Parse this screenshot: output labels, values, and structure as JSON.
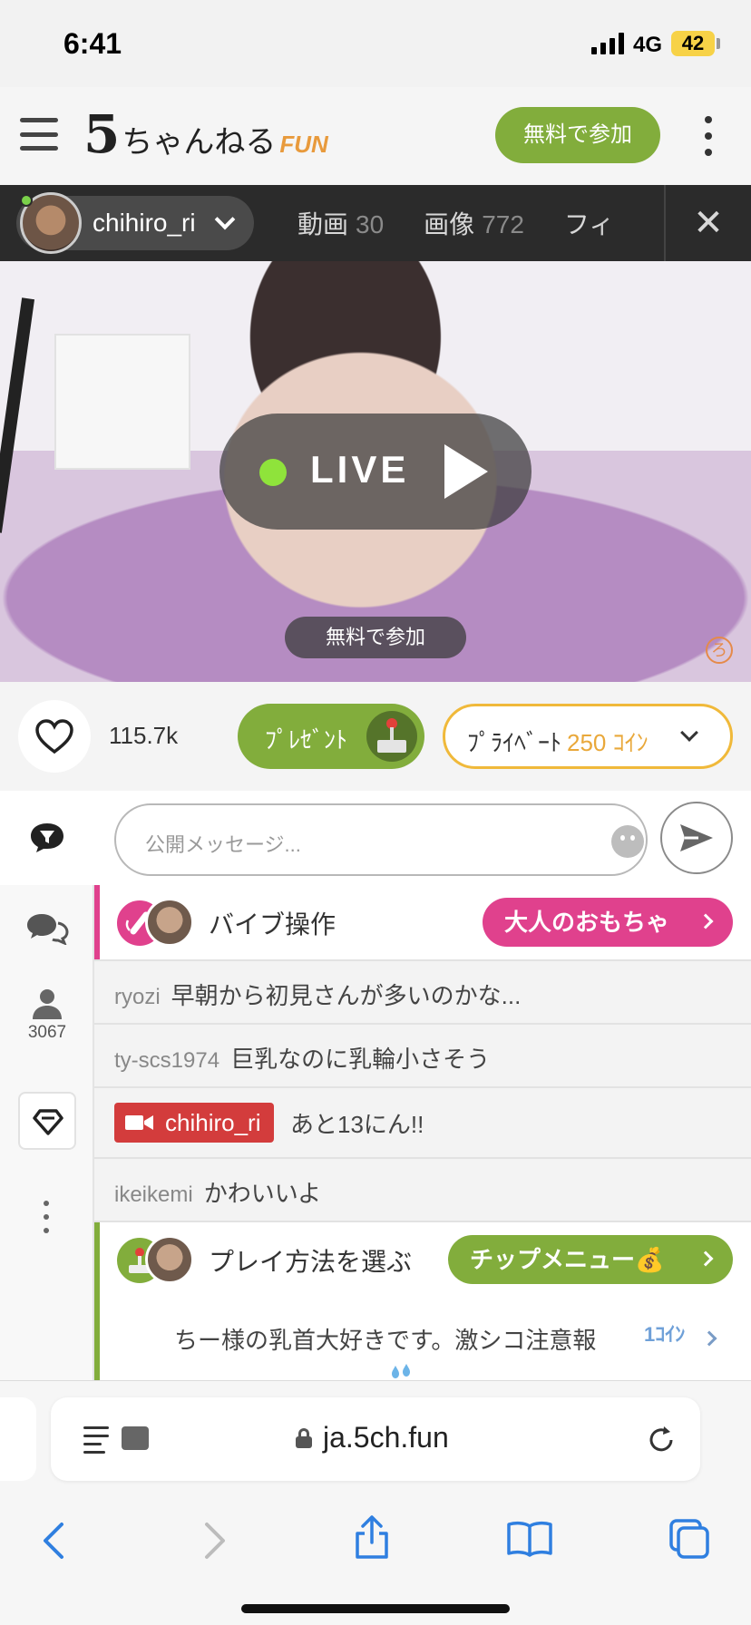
{
  "status_bar": {
    "time": "6:41",
    "network": "4G",
    "battery": "42"
  },
  "header": {
    "logo_main": "5",
    "logo_kana": "ちゃんねる",
    "logo_suffix": "FUN",
    "join_label": "無料で参加"
  },
  "user_bar": {
    "username": "chihiro_ri",
    "tabs": [
      {
        "label": "動画",
        "count": "30"
      },
      {
        "label": "画像",
        "count": "772"
      },
      {
        "label": "フィ",
        "count": ""
      }
    ]
  },
  "video": {
    "live_label": "LIVE",
    "join_label": "無料で参加",
    "watermark": "ろ"
  },
  "actions": {
    "likes": "115.7k",
    "present_label": "ﾌﾟﾚｾﾞﾝﾄ",
    "private_label": "ﾌﾟﾗｲﾍﾞｰﾄ",
    "private_cost": "250 ｺｲﾝ"
  },
  "rail": {
    "viewers": "3067"
  },
  "chat": {
    "placeholder": "公開メッセージ...",
    "vibe": {
      "title": "バイブ操作",
      "button": "大人のおもちゃ"
    },
    "messages": [
      {
        "user": "ryozi",
        "text": "早朝から初見さんが多いのかな..."
      },
      {
        "user": "ty-scs1974",
        "text": "巨乳なのに乳輪小さそう"
      },
      {
        "user": "chihiro_ri",
        "text": "あと13にん!!"
      },
      {
        "user": "ikeikemi",
        "text": "かわいいよ"
      }
    ],
    "play": {
      "title": "プレイ方法を選ぶ",
      "button": "チップメニュー💰",
      "tip_text": "ちー様の乳首大好きです。激シコ注意報",
      "tip_coin": "1ｺｲﾝ"
    }
  },
  "browser": {
    "url": "ja.5ch.fun"
  },
  "colors": {
    "green": "#82ad3c",
    "pink": "#e0418d",
    "gold": "#f0b93a",
    "red": "#d33c3c"
  }
}
